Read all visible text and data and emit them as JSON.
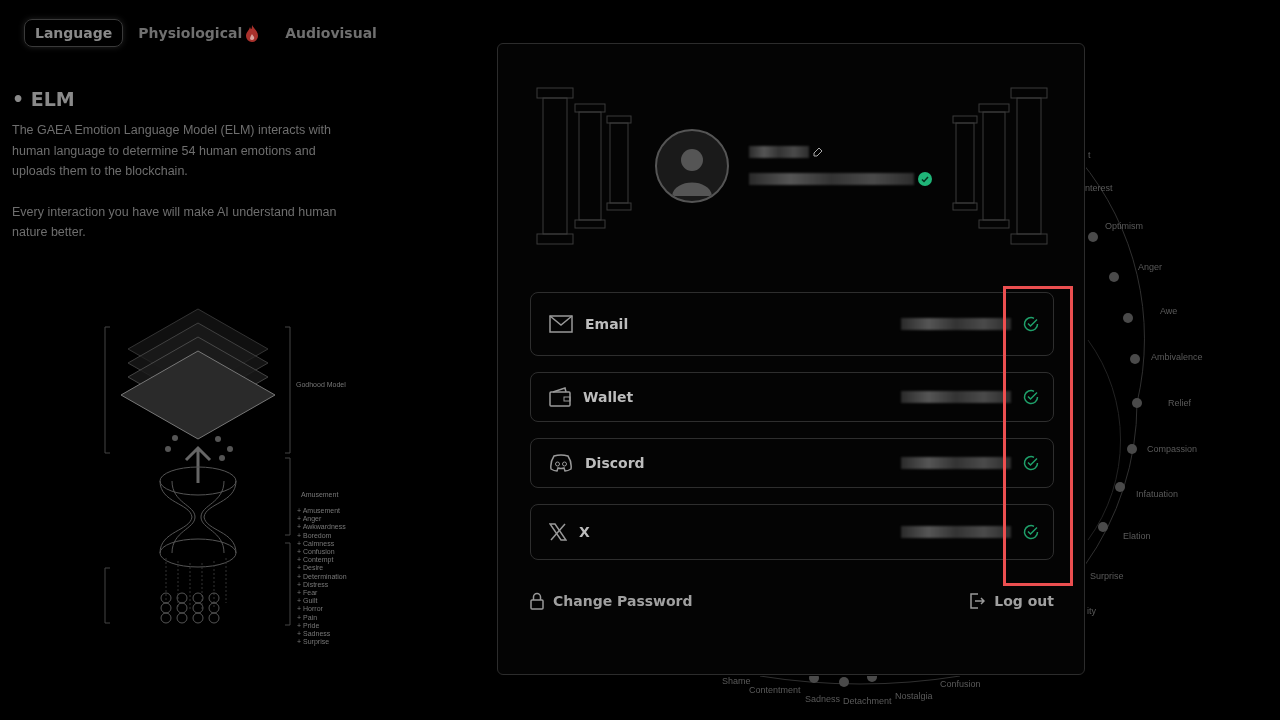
{
  "tabs": [
    {
      "label": "Language",
      "selected": true,
      "kind": "plain"
    },
    {
      "label": "Physiological",
      "selected": false,
      "kind": "flame"
    },
    {
      "label": "Audiovisual",
      "selected": false,
      "kind": "plain"
    }
  ],
  "section": {
    "title": "• ELM",
    "paragraphs": [
      "The GAEA Emotion Language Model (ELM) interacts with human language to determine 54 human emotions and uploads them to the blockchain.",
      "Every interaction you have will make AI understand human nature better."
    ]
  },
  "illustration": {
    "top_label": "Godhood Model",
    "middle_label": "Amusement",
    "emotions": [
      "+ Amusement",
      "+ Anger",
      "+ Awkwardness",
      "+ Boredom",
      "+ Calmness",
      "+ Confusion",
      "+ Contempt",
      "+ Desire",
      "+ Determination",
      "+ Distress",
      "+ Fear",
      "+ Guilt",
      "+ Horror",
      "+ Pain",
      "+ Pride",
      "+ Sadness",
      "+ Surprise"
    ]
  },
  "wheel_labels": [
    "t",
    "nterest",
    "Optimism",
    "Anger",
    "Awe",
    "Ambivalence",
    "Relief",
    "Compassion",
    "Infatuation",
    "Elation",
    "Surprise",
    "ity",
    "Shame",
    "Contentment",
    "Sadness",
    "Detachment",
    "Nostalgia",
    "Confusion"
  ],
  "profile": {
    "email_verified": true
  },
  "accounts": [
    {
      "kind": "email",
      "label": "Email",
      "verified": true
    },
    {
      "kind": "wallet",
      "label": "Wallet",
      "verified": true
    },
    {
      "kind": "discord",
      "label": "Discord",
      "verified": true
    },
    {
      "kind": "x",
      "label": "X",
      "verified": true
    }
  ],
  "footer": {
    "change_password": "Change Password",
    "log_out": "Log out"
  }
}
